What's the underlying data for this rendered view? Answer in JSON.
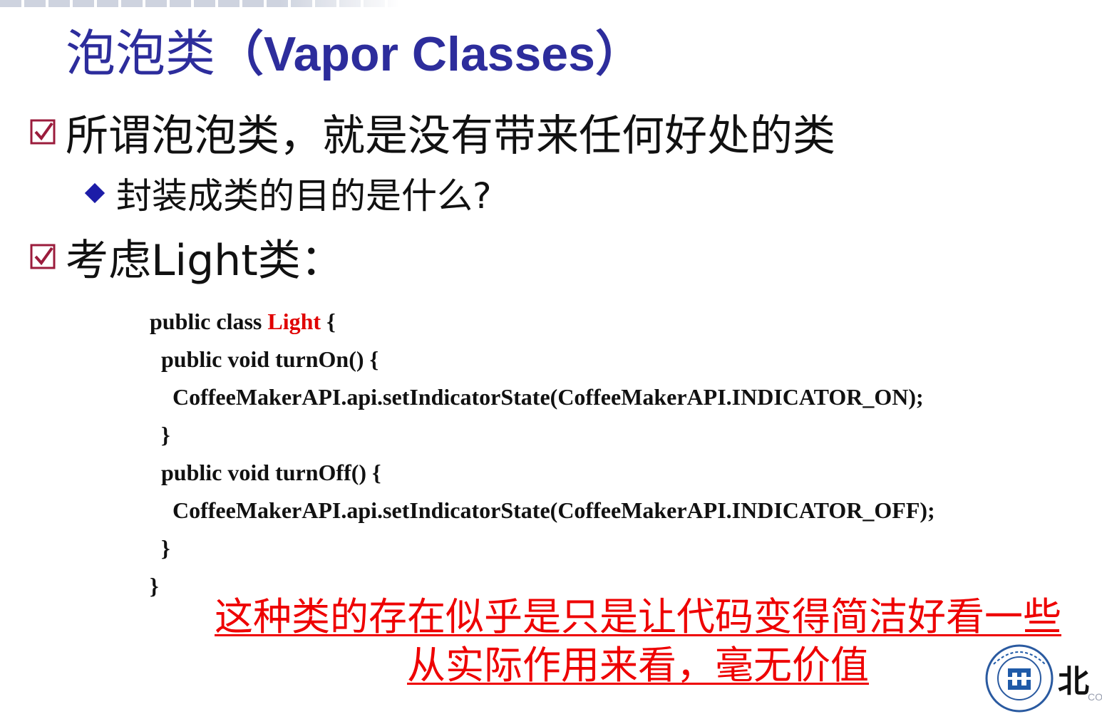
{
  "slide": {
    "title_cn": "泡泡类",
    "title_en": "（Vapor Classes）",
    "bullets": [
      {
        "icon": "check-box-icon",
        "text": "所谓泡泡类，就是没有带来任何好处的类"
      },
      {
        "icon": "diamond-bullet-icon",
        "text": "封装成类的目的是什么?"
      },
      {
        "icon": "check-box-icon",
        "text": "考虑Light类："
      }
    ],
    "code": {
      "line1_prefix": "public class ",
      "line1_class": "Light",
      "line1_suffix": " {",
      "line2": "  public void turnOn() {",
      "line3": "    CoffeeMakerAPI.api.setIndicatorState(CoffeeMakerAPI.INDICATOR_ON);",
      "line4": "  }",
      "line5": "  public void turnOff() {",
      "line6": "    CoffeeMakerAPI.api.setIndicatorState(CoffeeMakerAPI.INDICATOR_OFF);",
      "line7": "  }",
      "line8": "}"
    },
    "note": [
      "这种类的存在似乎是只是让代码变得简洁好看一些",
      "从实际作用来看，毫无价值"
    ],
    "logo": {
      "icon": "university-seal-icon",
      "text": "北",
      "sub": "CO"
    },
    "colors": {
      "title": "#2d2d9c",
      "checkbox": "#9b1c3c",
      "diamond": "#1c1ca8",
      "highlight": "#ee0000"
    }
  }
}
